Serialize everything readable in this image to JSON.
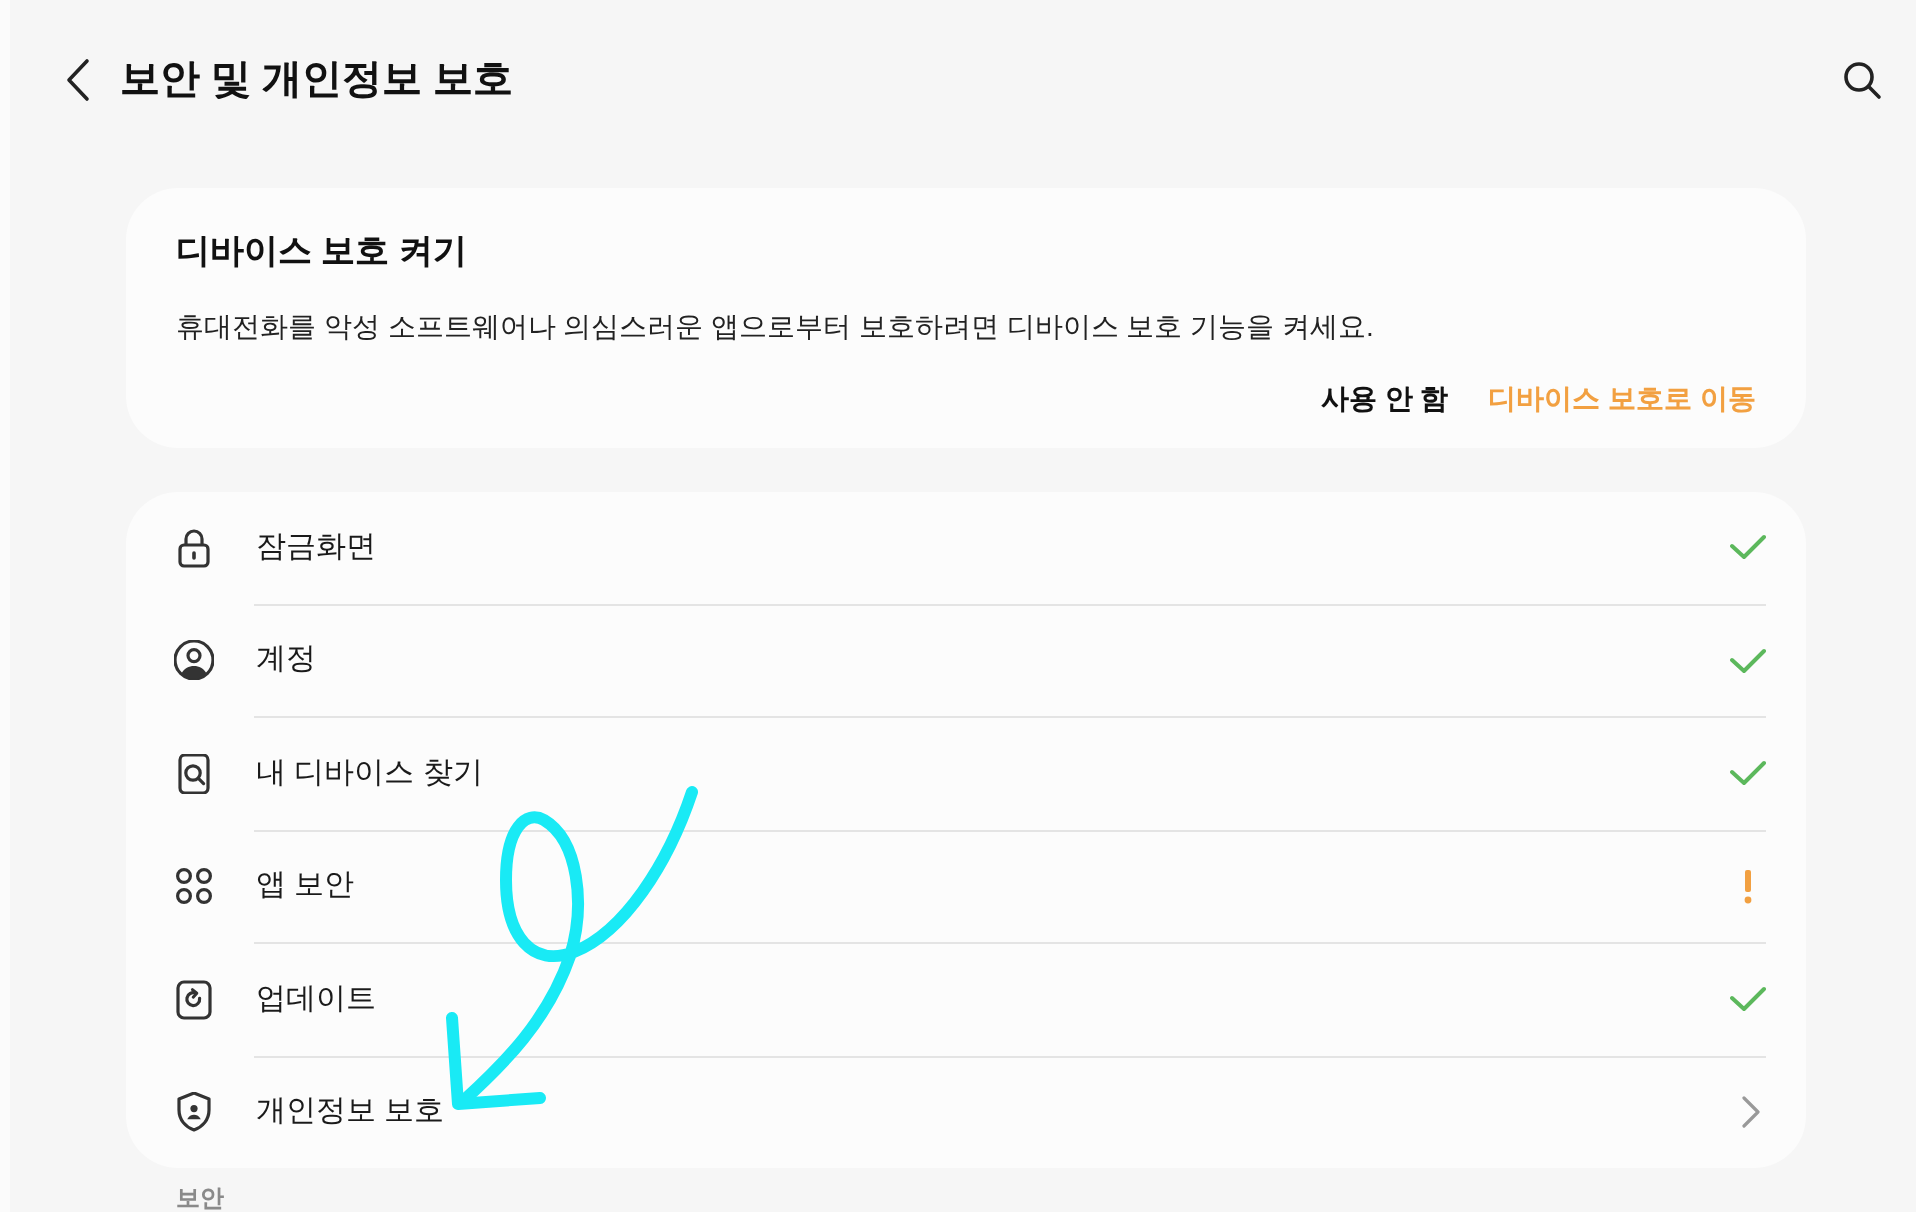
{
  "header": {
    "title": "보안 및 개인정보 보호"
  },
  "protection_card": {
    "title": "디바이스 보호 켜기",
    "description": "휴대전화를 악성 소프트웨어나 의심스러운 앱으로부터 보호하려면 디바이스 보호 기능을 켜세요.",
    "actions": [
      {
        "label": "사용 안 함",
        "kind": "secondary"
      },
      {
        "label": "디바이스 보호로 이동",
        "kind": "primary"
      }
    ]
  },
  "items": [
    {
      "label": "잠금화면",
      "kind": "ok"
    },
    {
      "label": "계정",
      "kind": "ok"
    },
    {
      "label": "내 디바이스 찾기",
      "kind": "ok"
    },
    {
      "label": "앱 보안",
      "kind": "warning"
    },
    {
      "label": "업데이트",
      "kind": "ok"
    },
    {
      "label": "개인정보 보호",
      "kind": "link"
    }
  ],
  "section_header": "보안",
  "annotation": {
    "kind": "arrow"
  }
}
